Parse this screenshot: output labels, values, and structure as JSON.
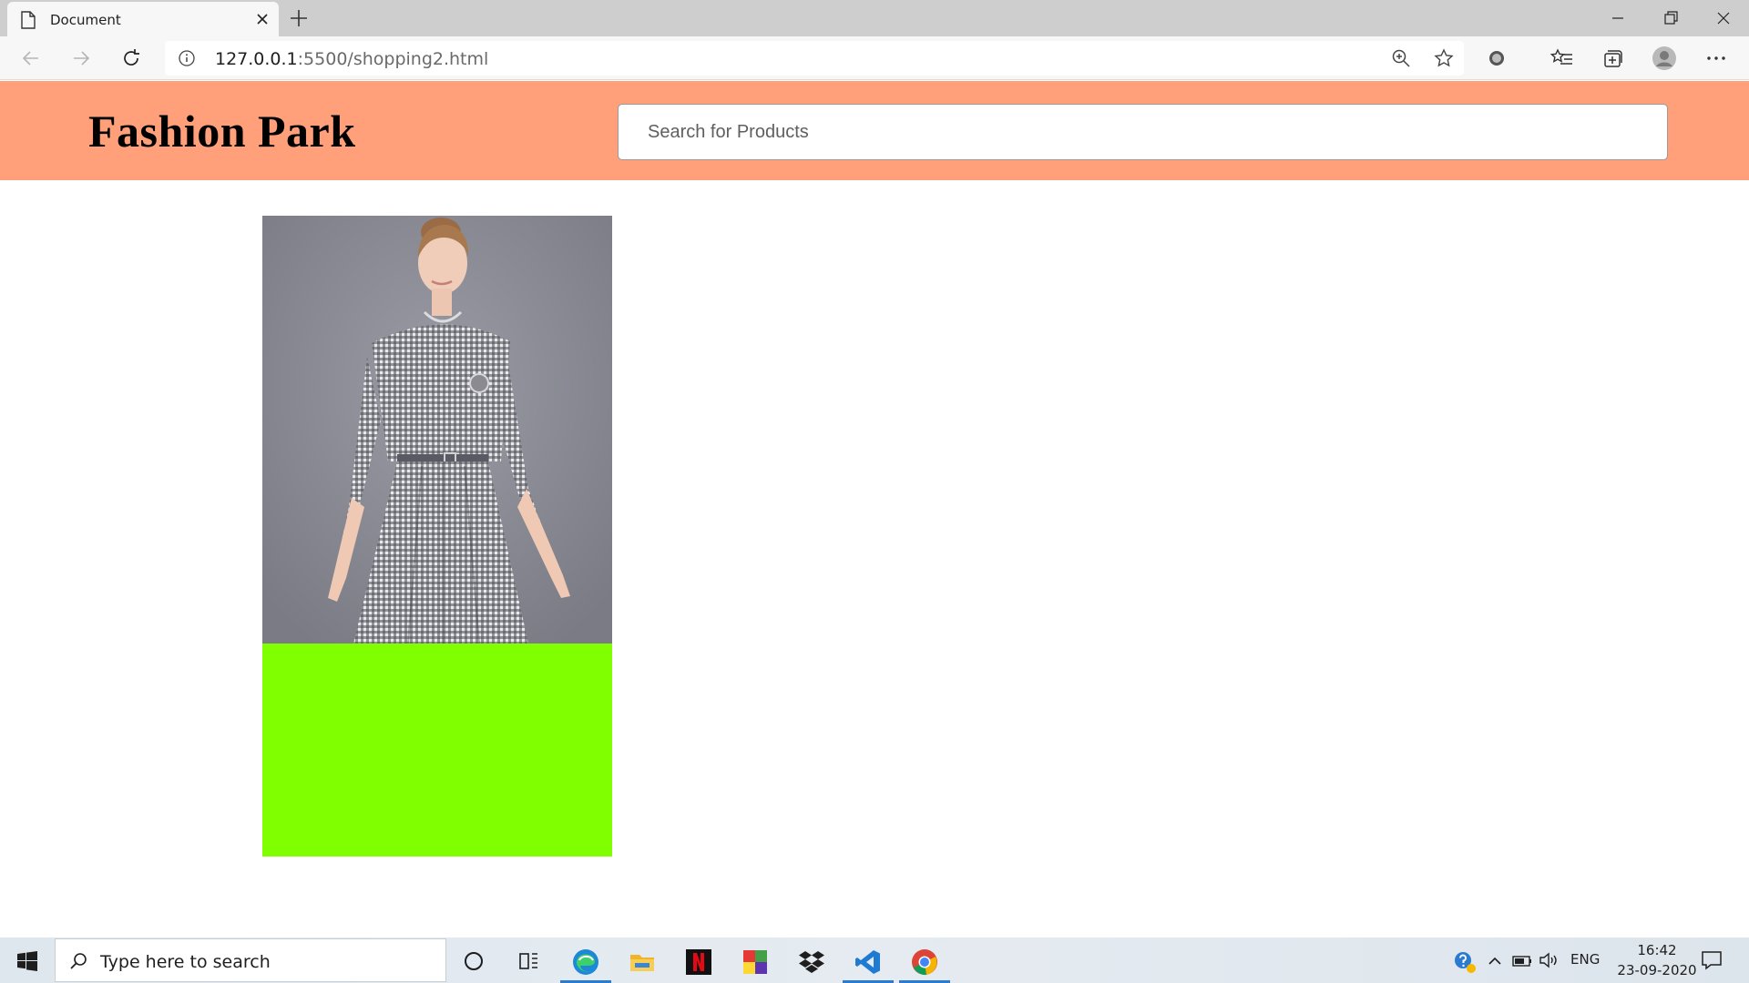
{
  "browser": {
    "tab_title": "Document",
    "url_host": "127.0.0.1",
    "url_rest": ":5500/shopping2.html",
    "icons": [
      "page-icon",
      "close-icon",
      "plus-icon",
      "minimize-icon",
      "restore-icon",
      "window-close-icon",
      "back-icon",
      "forward-icon",
      "refresh-icon",
      "info-icon",
      "zoom-icon",
      "star-icon",
      "extension-icon",
      "favorites-icon",
      "collections-icon",
      "profile-icon",
      "more-icon"
    ]
  },
  "page": {
    "brand": "Fashion Park",
    "search": {
      "placeholder": "Search for Products",
      "value": ""
    },
    "colors": {
      "header_bg": "#ffa07a",
      "card_info_bg": "#7fff00"
    },
    "product": {
      "image": "woman in black and white gingham checked dress"
    }
  },
  "taskbar": {
    "search_placeholder": "Type here to search",
    "apps": [
      "cortana-icon",
      "task-view-icon",
      "edge-icon",
      "file-explorer-icon",
      "netflix-icon",
      "app-icon",
      "dropbox-icon",
      "vscode-icon",
      "chrome-icon"
    ],
    "language": "ENG",
    "time": "16:42",
    "date": "23-09-2020"
  }
}
